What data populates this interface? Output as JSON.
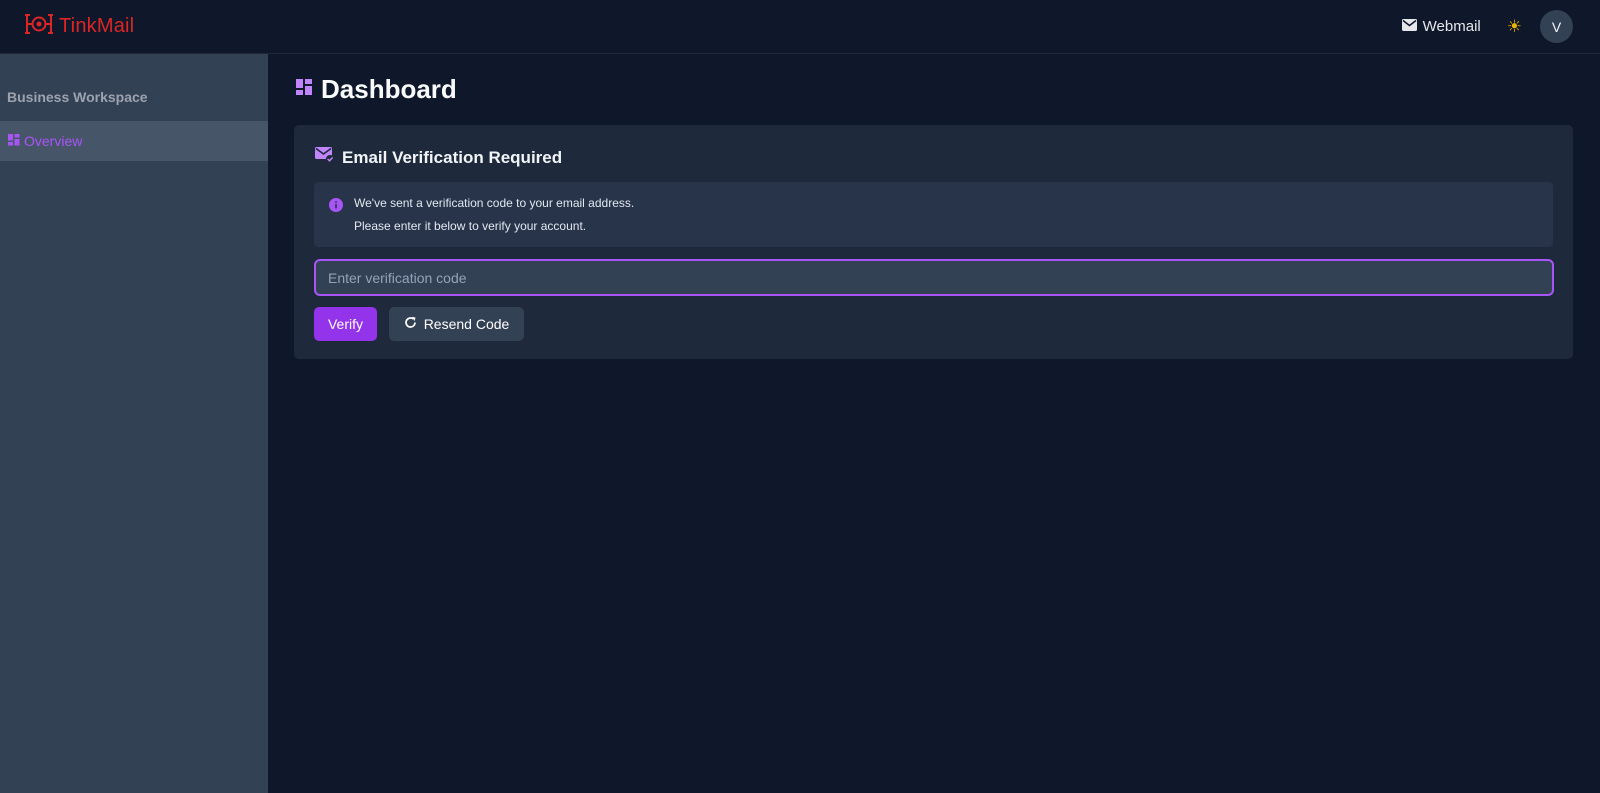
{
  "brand": {
    "name": "TinkMail",
    "logo_icon": "tinkmail-logo-icon",
    "color": "#dc2626"
  },
  "topbar": {
    "webmail_label": "Webmail",
    "webmail_icon": "mail-icon",
    "theme_icon": "sun-icon",
    "avatar_initial": "V"
  },
  "sidebar": {
    "workspace_title": "Business Workspace",
    "items": [
      {
        "label": "Overview",
        "icon": "dashboard-icon",
        "active": true
      }
    ]
  },
  "main": {
    "page_title": "Dashboard",
    "page_icon": "dashboard-icon",
    "verification": {
      "title": "Email Verification Required",
      "icon": "mark-email-read-icon",
      "info_icon": "info-icon",
      "message_line1": "We've sent a verification code to your email address.",
      "message_line2": "Please enter it below to verify your account.",
      "input_value": "",
      "input_placeholder": "Enter verification code",
      "verify_label": "Verify",
      "resend_label": "Resend Code",
      "resend_icon": "refresh-icon"
    }
  },
  "colors": {
    "accent": "#a855f7",
    "button_primary": "#9333ea",
    "background": "#0f172a",
    "sidebar": "#334155",
    "card": "#1e293b"
  }
}
